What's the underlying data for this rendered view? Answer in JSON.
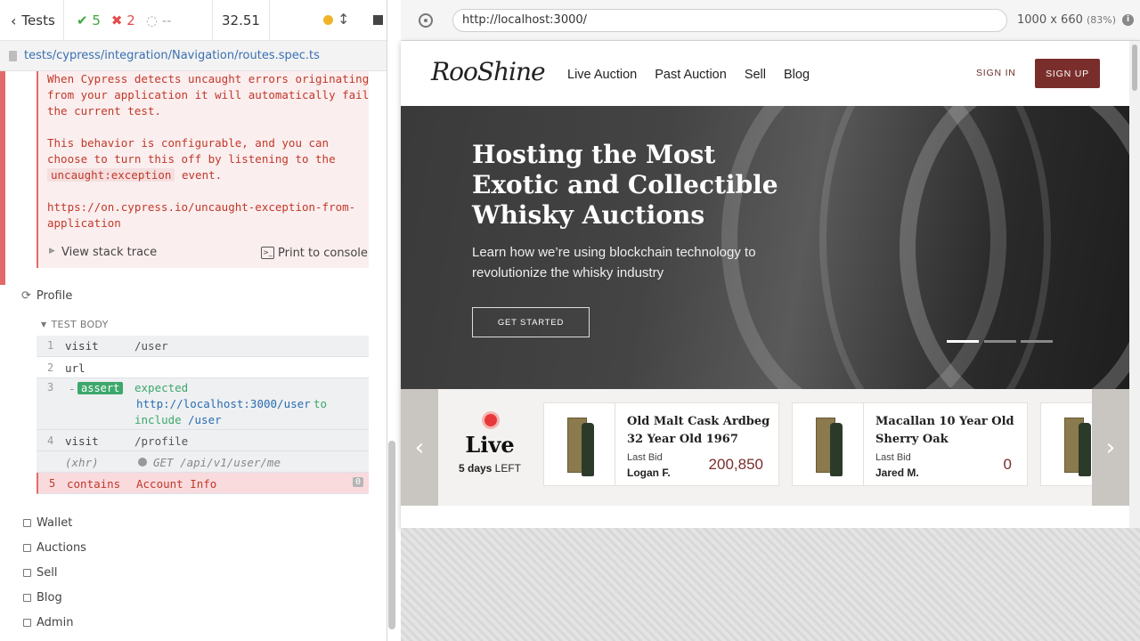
{
  "reporter": {
    "header": {
      "back_label": "Tests",
      "passed": "5",
      "failed": "2",
      "pending": "--",
      "duration": "32.51"
    },
    "spec_path": "tests/cypress/integration/Navigation/routes.spec.ts",
    "error": {
      "line1": "When Cypress detects uncaught errors originating",
      "line2": "from your application it will automatically fail",
      "line3": "the current test.",
      "line4": "This behavior is configurable, and you can",
      "line5": "choose to turn this off by listening to the",
      "event_code": "uncaught:exception",
      "event_suffix": " event.",
      "link1": "https://on.cypress.io/uncaught-exception-from-",
      "link2": "application",
      "stack_label": "View stack trace",
      "print_label": "Print to console"
    },
    "test_title": "Profile",
    "test_body_label": "TEST BODY",
    "commands": [
      {
        "num": "1",
        "name": "visit",
        "msg": "/user"
      },
      {
        "num": "2",
        "name": "url",
        "msg": ""
      },
      {
        "num": "3",
        "name": "assert",
        "prefix": "-",
        "msg_parts": [
          "expected",
          "http://localhost:3000/user",
          "to",
          "include",
          "/user"
        ]
      },
      {
        "num": "4",
        "name": "visit",
        "msg": "/profile"
      },
      {
        "num": "",
        "name": "(xhr)",
        "msg": "GET /api/v1/user/me"
      },
      {
        "num": "5",
        "name": "contains",
        "msg": "Account Info",
        "badge": "0"
      }
    ],
    "suites": [
      "Wallet",
      "Auctions",
      "Sell",
      "Blog",
      "Admin"
    ]
  },
  "aut": {
    "url": "http://localhost:3000/",
    "viewport": "1000 x 660",
    "scale": "(83%)",
    "site": {
      "logo": "RooShine",
      "nav": [
        "Live Auction",
        "Past Auction",
        "Sell",
        "Blog"
      ],
      "signin": "SIGN IN",
      "signup": "SIGN UP",
      "hero_title": "Hosting the Most Exotic and Collectible Whisky Auctions",
      "hero_sub": "Learn how we’re using blockchain technology to revolutionize the whisky industry",
      "hero_cta": "GET STARTED",
      "live_word": "Live",
      "live_days": "5 days",
      "live_left": " LEFT",
      "cards": [
        {
          "title": "Old Malt Cask Ardbeg 32 Year Old 1967",
          "last_bid_label": "Last Bid",
          "bidder": "Logan F.",
          "amount": "200,850"
        },
        {
          "title": "Macallan 10 Year Old Sherry Oak",
          "last_bid_label": "Last Bid",
          "bidder": "Jared M.",
          "amount": "0"
        }
      ],
      "colors": {
        "brand": "#7a2e2b",
        "live_dot": "#e8393a"
      }
    }
  }
}
